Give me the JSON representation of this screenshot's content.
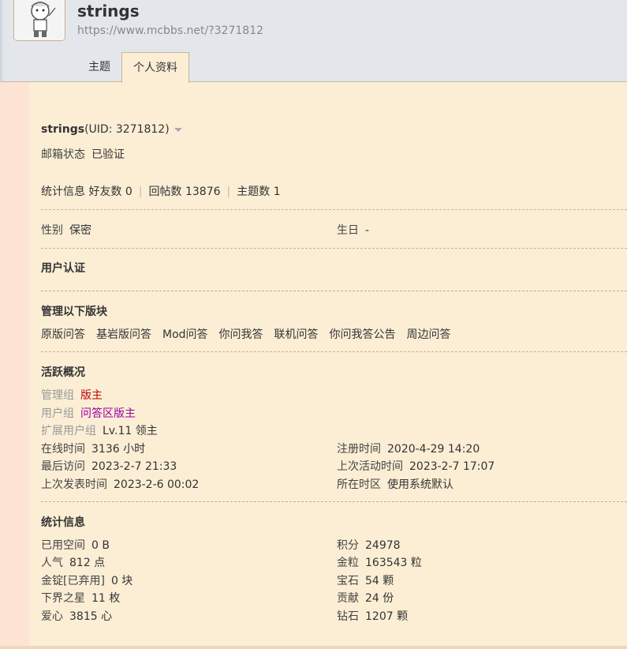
{
  "profile": {
    "name": "strings",
    "url": "https://www.mcbbs.net/?3271812",
    "uid_text": "(UID: 3271812)"
  },
  "tabs": [
    {
      "label": "主题"
    },
    {
      "label": "个人资料"
    }
  ],
  "email": {
    "label": "邮箱状态",
    "value": "已验证"
  },
  "stats_line": {
    "label": "统计信息",
    "friends": "好友数 0",
    "replies": "回帖数 13876",
    "threads": "主题数 1"
  },
  "gender": {
    "label": "性别",
    "value": "保密"
  },
  "birthday": {
    "label": "生日",
    "value": "-"
  },
  "verification_title": "用户认证",
  "managed": {
    "title": "管理以下版块",
    "forums": [
      "原版问答",
      "基岩版问答",
      "Mod问答",
      "你问我答",
      "联机问答",
      "你问我答公告",
      "周边问答"
    ]
  },
  "activity": {
    "title": "活跃概况",
    "admin_group": {
      "label": "管理组",
      "value": "版主"
    },
    "user_group": {
      "label": "用户组",
      "value": "问答区版主"
    },
    "ext_group": {
      "label": "扩展用户组",
      "value": "Lv.11 领主"
    },
    "online": {
      "label": "在线时间",
      "value": "3136 小时"
    },
    "register": {
      "label": "注册时间",
      "value": "2020-4-29 14:20"
    },
    "last_visit": {
      "label": "最后访问",
      "value": "2023-2-7 21:33"
    },
    "last_active": {
      "label": "上次活动时间",
      "value": "2023-2-7 17:07"
    },
    "last_post": {
      "label": "上次发表时间",
      "value": "2023-2-6 00:02"
    },
    "timezone": {
      "label": "所在时区",
      "value": "使用系统默认"
    }
  },
  "statistics": {
    "title": "统计信息",
    "used_space": {
      "label": "已用空间",
      "value": "0 B"
    },
    "points": {
      "label": "积分",
      "value": "24978"
    },
    "popularity": {
      "label": "人气",
      "value": "812 点"
    },
    "gold": {
      "label": "金粒",
      "value": "163543 粒"
    },
    "ingot": {
      "label": "金锭[已弃用]",
      "value": "0 块"
    },
    "gem": {
      "label": "宝石",
      "value": "54 颗"
    },
    "nether_star": {
      "label": "下界之星",
      "value": "11 枚"
    },
    "contribution": {
      "label": "贡献",
      "value": "24 份"
    },
    "love": {
      "label": "爱心",
      "value": "3815 心"
    },
    "diamond": {
      "label": "钻石",
      "value": "1207 颗"
    }
  },
  "colors": {
    "background": "#fbeed5",
    "header": "#e3e7ec",
    "admin": "#c00000",
    "usergroup": "#9b00a8"
  }
}
